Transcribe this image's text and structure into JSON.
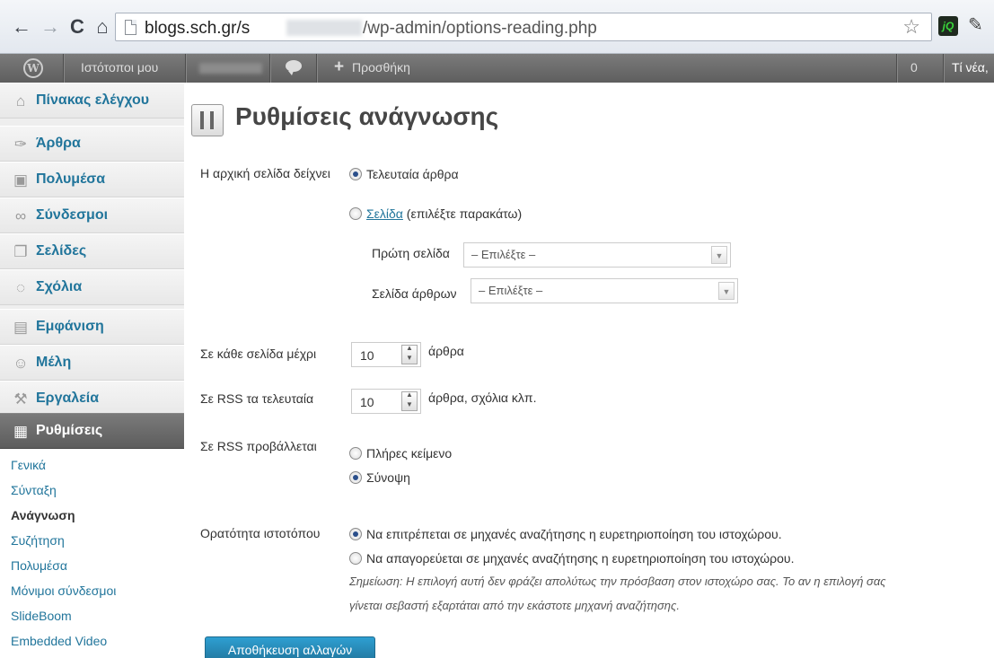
{
  "browser": {
    "url_host": "blogs.sch.gr/s",
    "url_path": "/wp-admin/options-reading.php",
    "ext_jq_label": "jQ"
  },
  "adminbar": {
    "logo": "W",
    "my_sites": "Ιστότοποι μου",
    "new_label": "Προσθήκη",
    "count": "0",
    "news": "Τί νέα,"
  },
  "sidebar": {
    "items": [
      {
        "label": "Πίνακας ελέγχου",
        "icon": "house-icon"
      },
      {
        "label": "Άρθρα",
        "icon": "pin-icon"
      },
      {
        "label": "Πολυμέσα",
        "icon": "media-icon"
      },
      {
        "label": "Σύνδεσμοι",
        "icon": "link-icon"
      },
      {
        "label": "Σελίδες",
        "icon": "pages-icon"
      },
      {
        "label": "Σχόλια",
        "icon": "comment-icon"
      },
      {
        "label": "Εμφάνιση",
        "icon": "appearance-icon"
      },
      {
        "label": "Μέλη",
        "icon": "users-icon"
      },
      {
        "label": "Εργαλεία",
        "icon": "tools-icon"
      },
      {
        "label": "Ρυθμίσεις",
        "icon": "settings-icon"
      }
    ],
    "submenu": [
      "Γενικά",
      "Σύνταξη",
      "Ανάγνωση",
      "Συζήτηση",
      "Πολυμέσα",
      "Μόνιμοι σύνδεσμοι",
      "SlideBoom",
      "Embedded Video"
    ]
  },
  "main": {
    "title": "Ρυθμίσεις ανάγνωσης",
    "front_page": {
      "label": "Η αρχική σελίδα δείχνει",
      "option_latest": "Τελευταία άρθρα",
      "option_page_link": "Σελίδα",
      "option_page_rest": " (επιλέξτε παρακάτω)",
      "front_label": "Πρώτη σελίδα",
      "front_value": "– Επιλέξτε –",
      "posts_label": "Σελίδα άρθρων",
      "posts_value": "– Επιλέξτε –"
    },
    "posts_per_page": {
      "label": "Σε κάθε σελίδα μέχρι",
      "value": "10",
      "unit": "άρθρα"
    },
    "rss_items": {
      "label": "Σε RSS τα τελευταία",
      "value": "10",
      "unit": "άρθρα, σχόλια κλπ."
    },
    "rss_show": {
      "label": "Σε RSS προβάλλεται",
      "full": "Πλήρες κείμενο",
      "summary": "Σύνοψη"
    },
    "visibility": {
      "label": "Ορατότητα ιστοτόπου",
      "allow": "Να επιτρέπεται σε μηχανές αναζήτησης η ευρετηριοποίηση του ιστοχώρου.",
      "block": "Να απαγορεύεται σε μηχανές αναζήτησης η ευρετηριοποίηση του ιστοχώρου.",
      "note_line1": "Σημείωση: Η επιλογή αυτή δεν φράζει απολύτως την πρόσβαση στον ιστοχώρο σας. Το αν η επιλογή σας",
      "note_line2": "γίνεται σεβαστή εξαρτάται από την εκάστοτε μηχανή αναζήτησης."
    },
    "save_label": "Αποθήκευση αλλαγών"
  }
}
